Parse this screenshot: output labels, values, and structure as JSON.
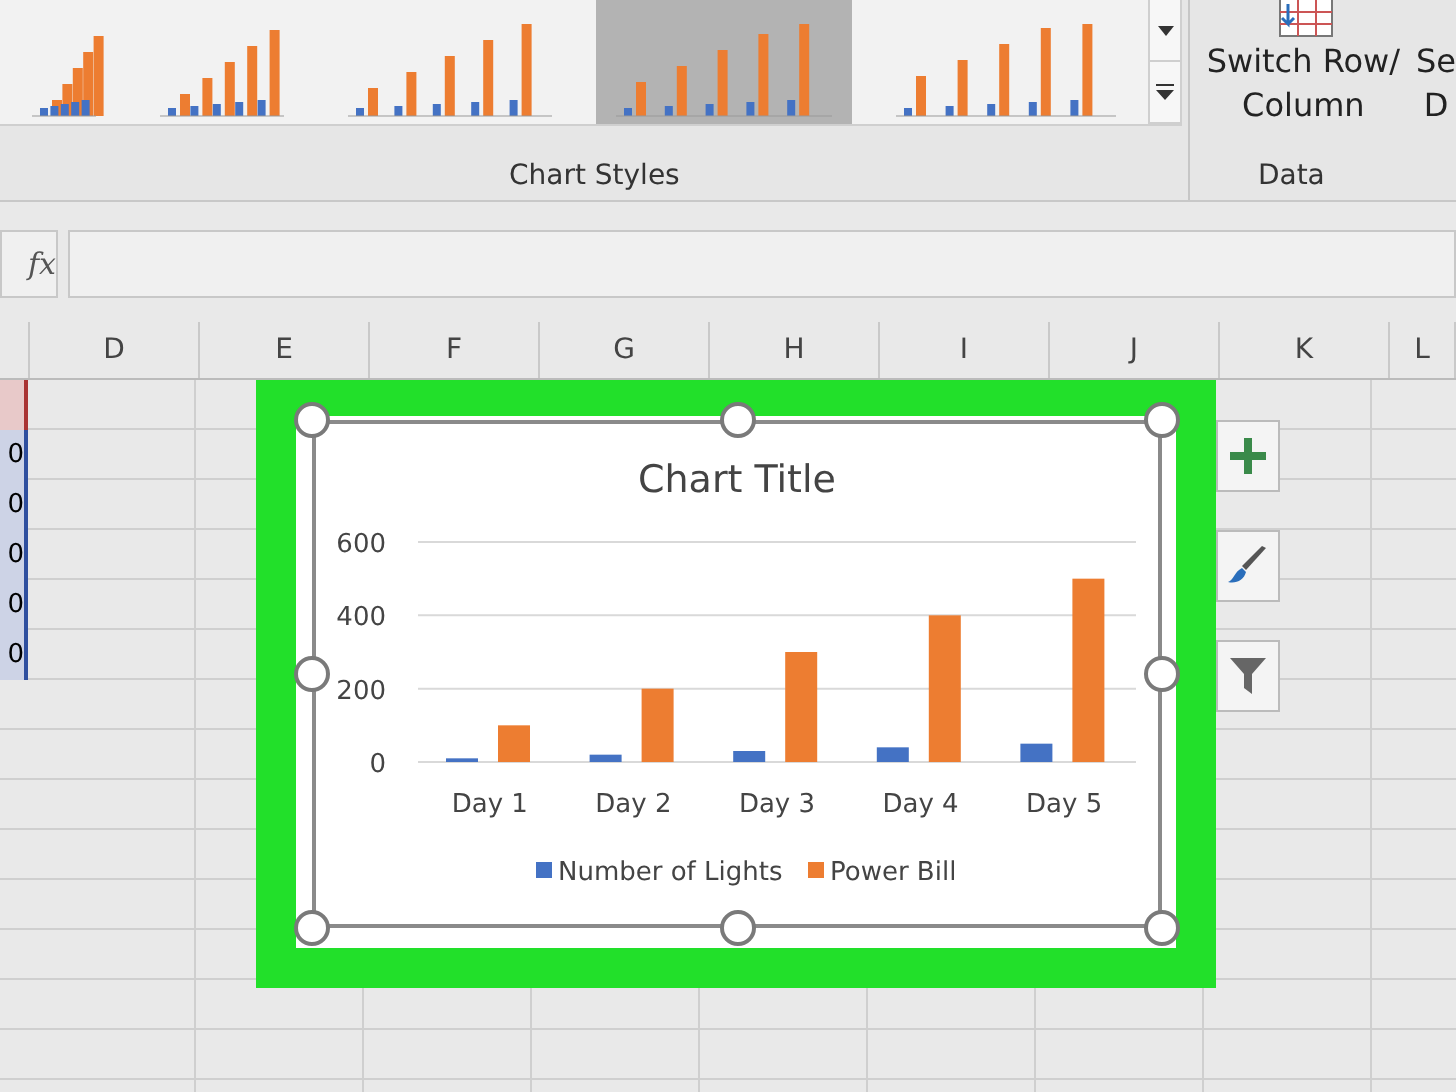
{
  "ribbon": {
    "chart_styles": [
      {
        "selected": false
      },
      {
        "selected": false
      },
      {
        "selected": false
      },
      {
        "selected": true
      },
      {
        "selected": false
      }
    ],
    "groups": [
      {
        "label": "Chart Styles"
      },
      {
        "label": "Data"
      }
    ],
    "buttons": [
      {
        "label_lines": [
          "Switch Row/",
          "Column"
        ]
      },
      {
        "label_lines": [
          "Se",
          "D"
        ]
      }
    ]
  },
  "formula_bar": {
    "function_label": "fx"
  },
  "column_headers": [
    "D",
    "E",
    "F",
    "G",
    "H",
    "I",
    "J",
    "K",
    "L"
  ],
  "partial_column": {
    "values": [
      "0",
      "0",
      "0",
      "0",
      "0"
    ]
  },
  "chart": {
    "chart_data": {
      "type": "bar",
      "title": "Chart Title",
      "categories": [
        "Day 1",
        "Day 2",
        "Day 3",
        "Day 4",
        "Day 5"
      ],
      "ylim": [
        0,
        600
      ],
      "yticks": [
        0,
        200,
        400,
        600
      ],
      "legend": "bottom",
      "series": [
        {
          "name": "Number of Lights",
          "color": "#4472c4",
          "values": [
            10,
            20,
            30,
            40,
            50
          ]
        },
        {
          "name": "Power Bill",
          "color": "#ed7d31",
          "values": [
            100,
            200,
            300,
            400,
            500
          ]
        }
      ]
    }
  }
}
